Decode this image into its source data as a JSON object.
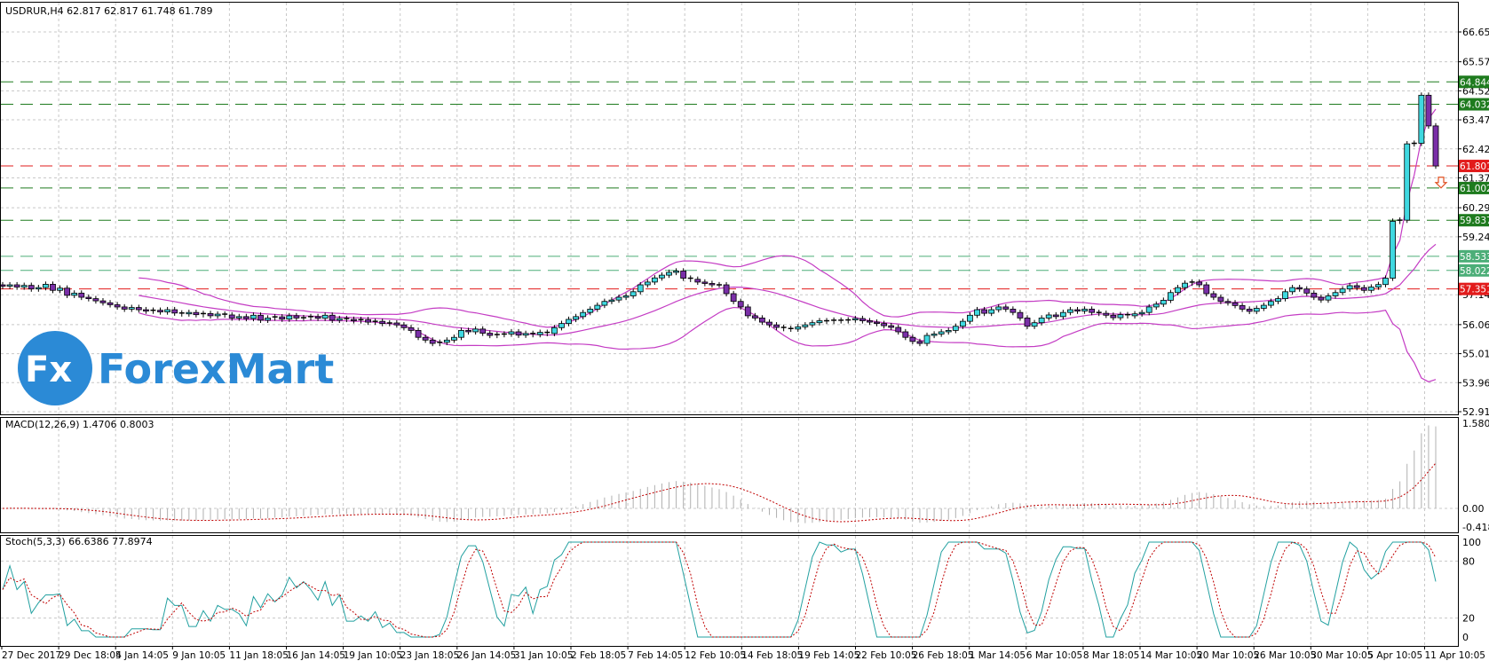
{
  "header": {
    "symbol_info": "USDRUR,H4  62.817 62.817 61.748 61.789",
    "macd_info": "MACD(12,26,9) 1.4706 0.8003",
    "stoch_info": "Stoch(5,3,3) 66.6386 77.8974"
  },
  "logo": {
    "fx": "Fx",
    "name": "ForexMart"
  },
  "colors": {
    "bull": "#3fd8e0",
    "bear": "#7a2fa8",
    "bands": "#c43cc4",
    "level_green": "#1e7b1e",
    "level_green_light": "#4cae78",
    "level_red": "#e21b1b",
    "macd_hist": "#b0b0b0",
    "signal": "#c00000",
    "stoch_main": "#22a0a0"
  },
  "chart_data": [
    {
      "type": "candlestick",
      "title": "USDRUR,H4",
      "ylim": [
        52.91,
        66.65
      ],
      "y_ticks": [
        "66.650",
        "65.570",
        "64.520",
        "63.470",
        "62.420",
        "61.370",
        "60.290",
        "59.240",
        "57.140",
        "56.060",
        "55.010",
        "53.960",
        "52.910"
      ],
      "x_ticks": [
        "27 Dec 2017",
        "29 Dec 18:05",
        "4 Jan 14:05",
        "9 Jan 10:05",
        "11 Jan 18:05",
        "16 Jan 14:05",
        "19 Jan 10:05",
        "23 Jan 18:05",
        "26 Jan 14:05",
        "31 Jan 10:05",
        "2 Feb 18:05",
        "7 Feb 14:05",
        "12 Feb 10:05",
        "14 Feb 18:05",
        "19 Feb 14:05",
        "22 Feb 10:05",
        "26 Feb 18:05",
        "1 Mar 14:05",
        "6 Mar 10:05",
        "8 Mar 18:05",
        "14 Mar 10:05",
        "20 Mar 10:05",
        "26 Mar 10:05",
        "30 Mar 10:05",
        "5 Apr 10:05",
        "11 Apr 10:05"
      ],
      "levels": [
        {
          "value": "64.844",
          "style": "green"
        },
        {
          "value": "64.032",
          "style": "green"
        },
        {
          "value": "61.801",
          "style": "red"
        },
        {
          "value": "61.002",
          "style": "green"
        },
        {
          "value": "59.837",
          "style": "green"
        },
        {
          "value": "58.533",
          "style": "green_light"
        },
        {
          "value": "58.022",
          "style": "green_light"
        },
        {
          "value": "57.351",
          "style": "red"
        }
      ],
      "indicator": "Bollinger Bands (20,2)",
      "signal_arrow": {
        "type": "sell",
        "price": 61.2
      },
      "closes": [
        57.45,
        57.5,
        57.42,
        57.48,
        57.35,
        57.4,
        57.52,
        57.3,
        57.38,
        57.12,
        57.2,
        57.05,
        57.0,
        56.92,
        56.85,
        56.78,
        56.7,
        56.62,
        56.68,
        56.6,
        56.55,
        56.58,
        56.52,
        56.6,
        56.48,
        56.45,
        56.5,
        56.42,
        56.46,
        56.38,
        56.44,
        56.41,
        56.3,
        56.35,
        56.28,
        56.4,
        56.22,
        56.3,
        56.34,
        56.26,
        56.38,
        56.3,
        56.31,
        56.35,
        56.29,
        56.4,
        56.22,
        56.28,
        56.25,
        56.2,
        56.24,
        56.15,
        56.18,
        56.1,
        56.12,
        56.05,
        55.95,
        55.85,
        55.6,
        55.5,
        55.38,
        55.42,
        55.5,
        55.6,
        55.85,
        55.8,
        55.9,
        55.75,
        55.67,
        55.7,
        55.72,
        55.8,
        55.68,
        55.74,
        55.7,
        55.78,
        55.74,
        55.95,
        56.1,
        56.25,
        56.35,
        56.5,
        56.62,
        56.76,
        56.9,
        56.95,
        57.05,
        57.1,
        57.25,
        57.5,
        57.6,
        57.75,
        57.85,
        57.95,
        58.0,
        57.74,
        57.7,
        57.6,
        57.55,
        57.5,
        57.5,
        57.18,
        56.9,
        56.7,
        56.38,
        56.3,
        56.15,
        56.05,
        55.96,
        55.92,
        55.9,
        55.98,
        56.05,
        56.13,
        56.2,
        56.18,
        56.22,
        56.2,
        56.23,
        56.28,
        56.2,
        56.15,
        56.1,
        56.02,
        55.96,
        55.8,
        55.6,
        55.45,
        55.38,
        55.67,
        55.72,
        55.8,
        55.85,
        56.0,
        56.18,
        56.4,
        56.6,
        56.47,
        56.6,
        56.7,
        56.62,
        56.5,
        56.3,
        56.0,
        56.13,
        56.3,
        56.41,
        56.35,
        56.5,
        56.6,
        56.55,
        56.62,
        56.5,
        56.47,
        56.4,
        56.31,
        56.42,
        56.38,
        56.45,
        56.5,
        56.7,
        56.8,
        56.94,
        57.22,
        57.4,
        57.56,
        57.6,
        57.5,
        57.18,
        57.05,
        56.9,
        56.85,
        56.75,
        56.62,
        56.54,
        56.65,
        56.76,
        56.9,
        57.0,
        57.25,
        57.4,
        57.35,
        57.2,
        57.05,
        56.95,
        57.1,
        57.22,
        57.35,
        57.47,
        57.4,
        57.3,
        57.42,
        57.51,
        57.74,
        59.8,
        59.84,
        62.6,
        62.62,
        64.36,
        63.25,
        61.8
      ]
    },
    {
      "type": "bar+line",
      "title": "MACD(12,26,9)",
      "values_text": [
        "1.4706",
        "0.8003"
      ],
      "ylim": [
        -0.4183,
        1.5802
      ],
      "y_ticks": [
        "1.5802",
        "0.00",
        "-0.4183"
      ]
    },
    {
      "type": "line",
      "title": "Stoch(5,3,3)",
      "values_text": [
        "66.6386",
        "77.8974"
      ],
      "ylim": [
        0,
        100
      ],
      "y_ticks": [
        "100",
        "80",
        "20",
        "0"
      ]
    }
  ]
}
